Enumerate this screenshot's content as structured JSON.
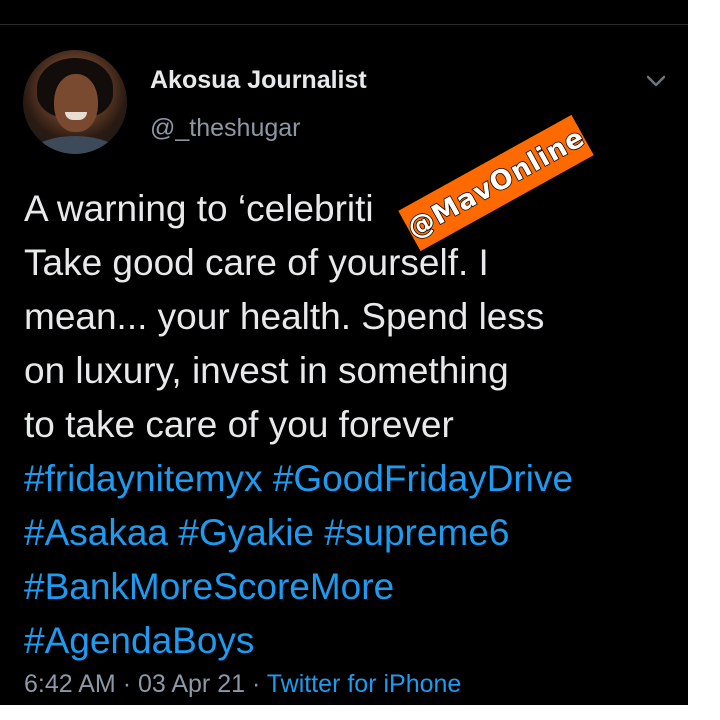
{
  "tweet": {
    "author": {
      "display_name": "Akosua Journalist",
      "handle": "@_theshugar"
    },
    "text_lines": [
      "A warning to ‘celebriti",
      "Take good care of yourself. I",
      "mean... your health. Spend less",
      "on luxury, invest in something",
      "to take care of you forever"
    ],
    "hashtag_lines": [
      [
        "#fridaynitemyx",
        "#GoodFridayDrive"
      ],
      [
        "#Asakaa",
        "#Gyakie",
        "#supreme6"
      ],
      [
        "#BankMoreScoreMore"
      ],
      [
        "#AgendaBoys"
      ]
    ],
    "time": "6:42 AM",
    "date": "03 Apr 21",
    "source": "Twitter for iPhone",
    "separator": "·"
  },
  "watermark": {
    "text": "@MavOnline"
  },
  "icons": {
    "menu": "chevron-down-icon",
    "avatar": "profile-photo"
  },
  "colors": {
    "background": "#000000",
    "text": "#e7e9ea",
    "secondary_text": "#8b98a5",
    "link": "#1d9bf0",
    "watermark": "#ff6a00"
  }
}
